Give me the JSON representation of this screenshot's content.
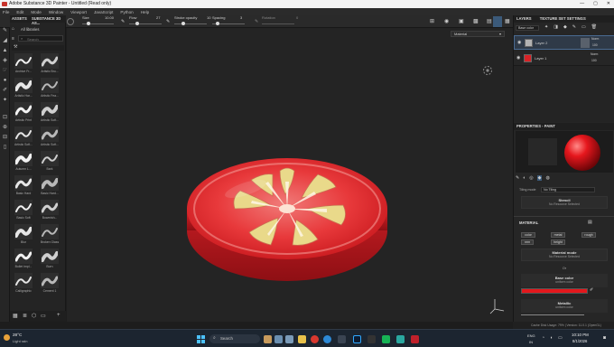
{
  "window": {
    "title": "Adobe Substance 3D Painter - Untitled (Read only)",
    "controls": [
      "—",
      "▢",
      "✕"
    ]
  },
  "menu": [
    "File",
    "Edit",
    "Mode",
    "Window",
    "Viewport",
    "JavaScript",
    "Python",
    "Help"
  ],
  "toolbar": {
    "assets_label": "ASSETS",
    "substance_label": "SUBSTANCE 3D AS...",
    "size_label": "Size",
    "size_value": "10.00",
    "flow_label": "Flow",
    "flow_value": "27",
    "stroke_opacity_label": "Stroke opacity",
    "stroke_opacity_value": "10",
    "spacing_label": "Spacing",
    "spacing_value": "3",
    "rotation_label": "Rotation",
    "rotation_value": "0"
  },
  "shelf": {
    "filter_label": "All libraries",
    "search_placeholder": "Search",
    "brushes": [
      "Archive Fr...",
      "Artistic Bru...",
      "Artistic Har...",
      "Artistic Fea...",
      "Artistic Print",
      "Artistic Soft...",
      "Artistic Soft...",
      "Artistic Soft...",
      "Autumn L...",
      "Bark",
      "Basic Hard",
      "Basic Hard...",
      "Basic Soft",
      "Bowmish...",
      "Blur",
      "Broken Glass",
      "Bullet Impl...",
      "Burn",
      "Calligraphic",
      "Cement 1"
    ]
  },
  "viewport": {
    "display_select": "Material"
  },
  "layers": {
    "tabs": [
      "LAYERS",
      "TEXTURE SET SETTINGS"
    ],
    "channel_select": "Base color",
    "items": [
      {
        "name": "Layer 2",
        "blend": "Norm",
        "opacity": "100"
      },
      {
        "name": "Layer 1",
        "blend": "Norm",
        "opacity": "100"
      }
    ]
  },
  "properties": {
    "title": "PROPERTIES - PAINT",
    "tiling_label": "Tiling mode",
    "tiling_value": "No Tiling",
    "stencil_label": "Stencil",
    "stencil_value": "No Resource Selected",
    "material_header": "MATERIAL",
    "channel_buttons": [
      "color",
      "metal",
      "rough",
      "nrm",
      "height"
    ],
    "material_mode_label": "Material mode",
    "material_mode_value": "No Resource Selected",
    "or_label": "Or",
    "base_color_label": "Base color",
    "base_color_sub": "uniform color",
    "base_color_hex": "#e3171c",
    "metallic_label": "Metallic",
    "metallic_sub": "uniform color"
  },
  "status": {
    "text": "Cache Disk Usage:  79% | Version: 11.0.1 (OpenGL)"
  },
  "taskbar": {
    "weather_temp": "28°C",
    "weather_desc": "Light rain",
    "search_placeholder": "Search",
    "time": "10:10 PM",
    "date": "8/1/2026",
    "lang": "ENG",
    "region": "IN"
  }
}
